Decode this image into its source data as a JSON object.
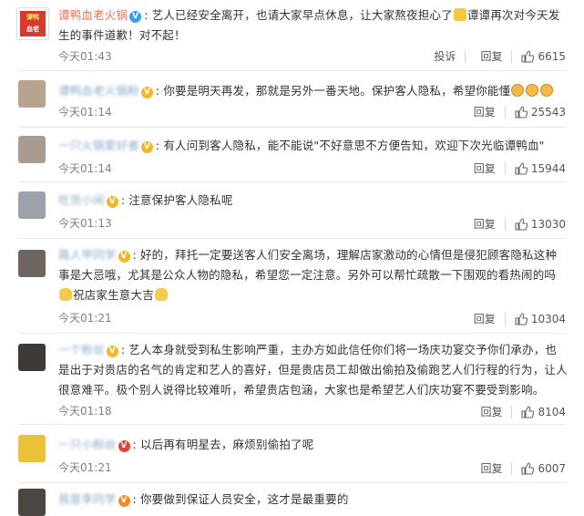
{
  "comments": [
    {
      "avatar": "brand-logo",
      "brand_line1": "谭鸭",
      "brand_line2": "血老",
      "name": "谭鸭血老火锅",
      "badge": "V",
      "badge_color": "#3c9dea",
      "text_before_emoji": "艺人已经安全离开，也请大家早点休息，让大家熬夜担心了",
      "emoji1": "pray-emoji",
      "text_after_emoji": "谭谭再次对今天发生的事件道歉！对不起！",
      "time": "今天01:43",
      "report": "投诉",
      "reply": "回复",
      "likes": "6615"
    },
    {
      "name": "谭鸭血老火锅粉",
      "badge": "V",
      "badge_color": "#f6b722",
      "text": "你要是明天再发，那就是另外一番天地。保护客人隐私，希望你能懂",
      "emoji1": "sad-emoji",
      "emoji2": "sad-emoji",
      "emoji3": "sad-emoji",
      "time": "今天01:14",
      "reply": "回复",
      "likes": "25543"
    },
    {
      "name": "一只火锅爱好者",
      "badge": "V",
      "badge_color": "#f6b722",
      "text": "有人问到客人隐私，能不能说\"不好意思不方便告知，欢迎下次光临谭鸭血\"",
      "time": "今天01:14",
      "reply": "回复",
      "likes": "15944"
    },
    {
      "name": "吃货小闲",
      "badge": "V",
      "badge_color": "#f6b722",
      "text": "注意保护客人隐私呢",
      "time": "今天01:13",
      "reply": "回复",
      "likes": "13030"
    },
    {
      "name": "路人甲同学",
      "badge": "V",
      "badge_color": "#f6b722",
      "text": "好的，拜托一定要送客人们安全离场，理解店家激动的心情但是侵犯顾客隐私这种事是大忌哦，尤其是公众人物的隐私，希望您一定注意。另外可以帮忙疏散一下围观的看热闹的吗",
      "emoji1": "person-emoji",
      "text_after_emoji": "祝店家生意大吉",
      "emoji2": "person-emoji",
      "time": "今天01:21",
      "reply": "回复",
      "likes": "10304"
    },
    {
      "name": "一个粉丝",
      "badge": "V",
      "badge_color": "#f6b722",
      "text": "艺人本身就受到私生影响严重，主办方如此信任你们将一场庆功宴交予你们承办，也是出于对贵店的名气的肯定和艺人的喜好，但是贵店员工却做出偷拍及偷跑艺人们行程的行为，让人很意难平。极个别人说得比较难听，希望贵店包涵，大家也是希望艺人们庆功宴不要受到影响。",
      "time": "今天01:18",
      "reply": "回复",
      "likes": "8104"
    },
    {
      "name": "一只小粉丝",
      "badge": "V",
      "badge_color": "#e93f34",
      "text": "以后再有明星去，麻烦别偷拍了呢",
      "time": "今天01:21",
      "reply": "回复",
      "likes": "6007"
    },
    {
      "name": "我是李同学",
      "badge": "V",
      "badge_color": "#f48b22",
      "text": "你要做到保证人员安全，这才是最重要的"
    }
  ],
  "colors": {
    "name": "#eb7350",
    "text": "#333333",
    "meta": "#808080",
    "divider": "#eaeaea"
  },
  "icons": {
    "like": "thumbs-up-icon"
  }
}
